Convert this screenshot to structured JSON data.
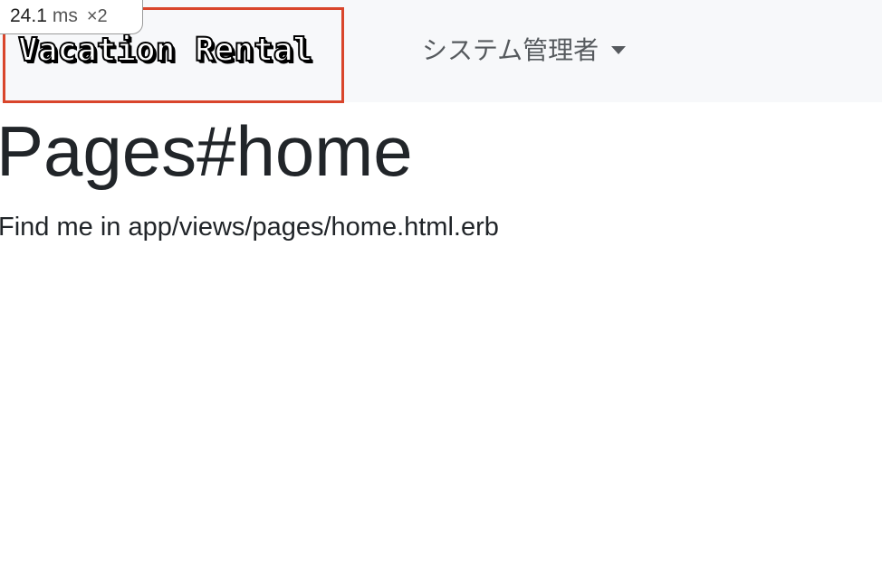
{
  "navbar": {
    "brand": "Vacation Rental",
    "dropdown_label": "システム管理者"
  },
  "perf_badge": {
    "time": "24.1",
    "unit": "ms",
    "multiplier": "×2"
  },
  "main": {
    "title": "Pages#home",
    "text": "Find me in app/views/pages/home.html.erb"
  },
  "colors": {
    "navbar_bg": "#f7f8fa",
    "highlight_border": "#d9452b",
    "text": "#212529",
    "nav_link": "#565a5e"
  },
  "icons": {
    "dropdown": "caret-down-icon"
  }
}
